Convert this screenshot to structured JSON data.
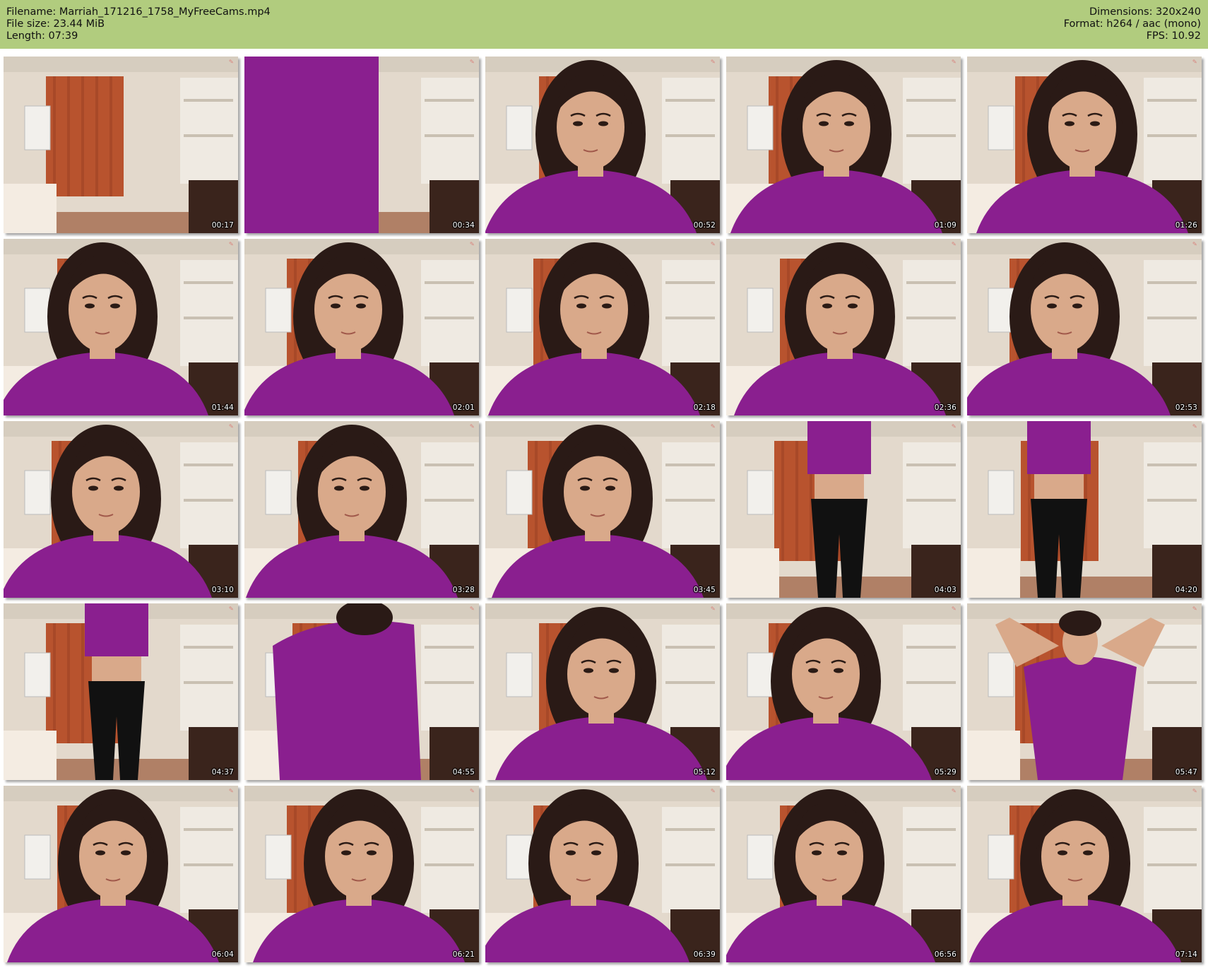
{
  "header": {
    "filename": "Filename: Marriah_171216_1758_MyFreeCams.mp4",
    "filesize": "File size: 23.44 MiB",
    "length": "Length: 07:39",
    "dimensions": "Dimensions: 320x240",
    "format": "Format: h264 / aac (mono)",
    "fps": "FPS: 10.92",
    "background_color": "#b1cc7e"
  },
  "thumbnails": [
    {
      "time": "00:17",
      "scene": "empty-room"
    },
    {
      "time": "00:34",
      "scene": "purple-blur"
    },
    {
      "time": "00:52",
      "scene": "face"
    },
    {
      "time": "01:09",
      "scene": "face"
    },
    {
      "time": "01:26",
      "scene": "face"
    },
    {
      "time": "01:44",
      "scene": "face"
    },
    {
      "time": "02:01",
      "scene": "face"
    },
    {
      "time": "02:18",
      "scene": "face"
    },
    {
      "time": "02:36",
      "scene": "face"
    },
    {
      "time": "02:53",
      "scene": "face"
    },
    {
      "time": "03:10",
      "scene": "face"
    },
    {
      "time": "03:28",
      "scene": "face"
    },
    {
      "time": "03:45",
      "scene": "face"
    },
    {
      "time": "04:03",
      "scene": "standing"
    },
    {
      "time": "04:20",
      "scene": "standing"
    },
    {
      "time": "04:37",
      "scene": "standing"
    },
    {
      "time": "04:55",
      "scene": "purple-close"
    },
    {
      "time": "05:12",
      "scene": "face"
    },
    {
      "time": "05:29",
      "scene": "face"
    },
    {
      "time": "05:47",
      "scene": "arms-up"
    },
    {
      "time": "06:04",
      "scene": "face"
    },
    {
      "time": "06:21",
      "scene": "face"
    },
    {
      "time": "06:39",
      "scene": "face"
    },
    {
      "time": "06:56",
      "scene": "face"
    },
    {
      "time": "07:14",
      "scene": "face"
    }
  ],
  "colors": {
    "wall": "#e3d9cc",
    "curtain": "#b8532e",
    "shirt": "#8a1f8f",
    "hair": "#2a1a16",
    "skin": "#d9a98a",
    "floor": "#9a5a3a"
  }
}
